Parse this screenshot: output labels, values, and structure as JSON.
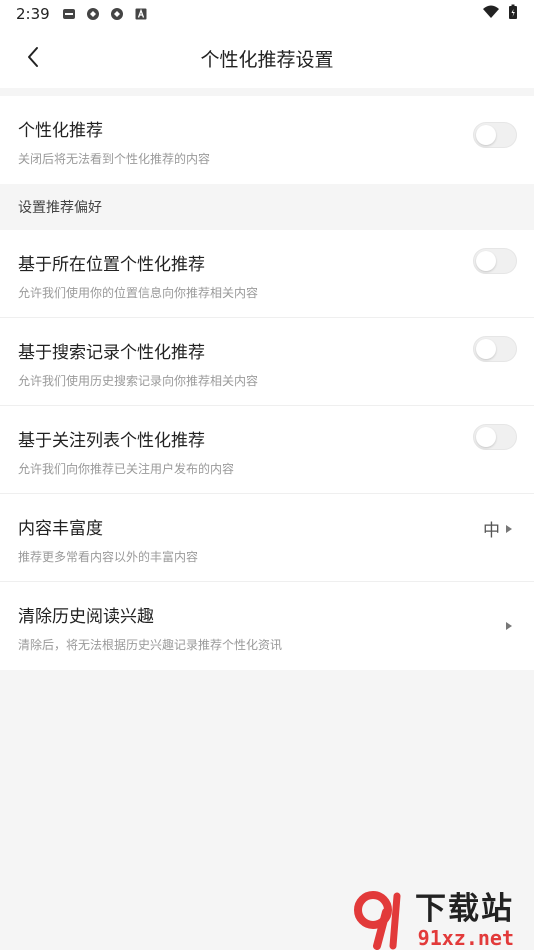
{
  "status": {
    "time": "2:39"
  },
  "header": {
    "title": "个性化推荐设置"
  },
  "main_toggle": {
    "label": "个性化推荐",
    "desc": "关闭后将无法看到个性化推荐的内容",
    "enabled": false
  },
  "section": {
    "title": "设置推荐偏好"
  },
  "prefs": [
    {
      "label": "基于所在位置个性化推荐",
      "desc": "允许我们使用你的位置信息向你推荐相关内容",
      "enabled": false
    },
    {
      "label": "基于搜索记录个性化推荐",
      "desc": "允许我们使用历史搜索记录向你推荐相关内容",
      "enabled": false
    },
    {
      "label": "基于关注列表个性化推荐",
      "desc": "允许我们向你推荐已关注用户发布的内容",
      "enabled": false
    }
  ],
  "richness": {
    "label": "内容丰富度",
    "desc": "推荐更多常看内容以外的丰富内容",
    "value": "中"
  },
  "clear": {
    "label": "清除历史阅读兴趣",
    "desc": "清除后，将无法根据历史兴趣记录推荐个性化资讯"
  },
  "watermark": {
    "cn": "下载站",
    "url": "91xz.net"
  },
  "colors": {
    "brand_red": "#e23a3a",
    "toggle_off": "#f0f0f0"
  }
}
